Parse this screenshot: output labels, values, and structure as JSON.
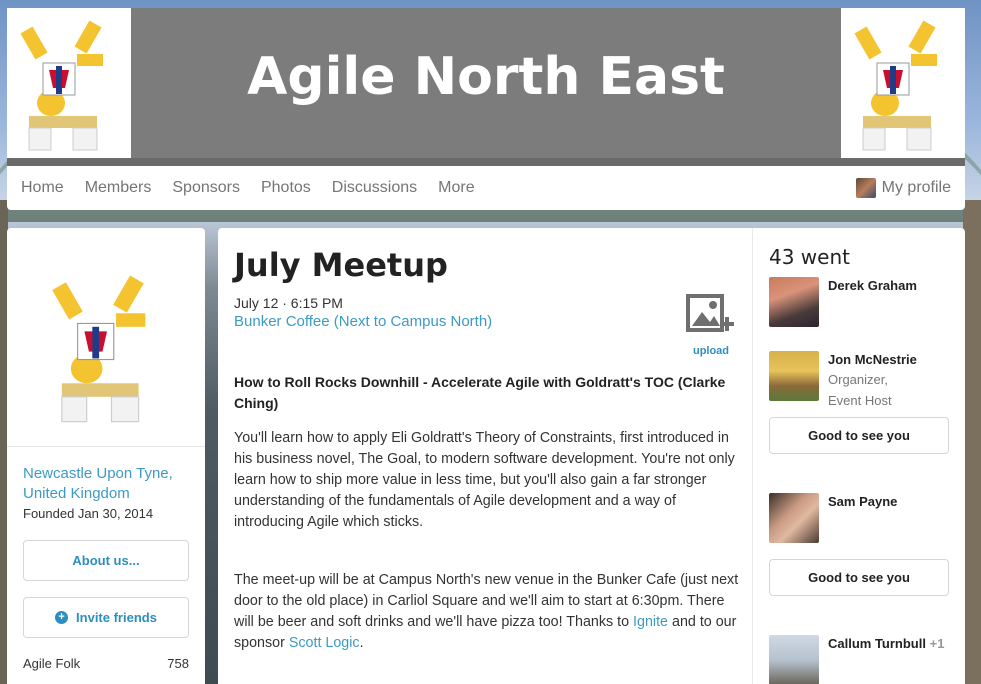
{
  "header": {
    "title": "Agile North East"
  },
  "nav": {
    "items": [
      "Home",
      "Members",
      "Sponsors",
      "Photos",
      "Discussions",
      "More"
    ],
    "profile_label": "My profile"
  },
  "group": {
    "location": "Newcastle Upon Tyne, United Kingdom",
    "founded": "Founded Jan 30, 2014",
    "about_label": "About us...",
    "invite_label": "Invite friends",
    "member_term": "Agile Folk",
    "member_count": "758"
  },
  "event": {
    "title": "July Meetup",
    "date": "July 12 · 6:15 PM",
    "venue": "Bunker Coffee (Next to Campus North)",
    "upload_label": "upload",
    "talk_title": "How to Roll Rocks Downhill - Accelerate Agile with Goldratt's TOC (Clarke Ching)",
    "para1": "You'll learn how to apply Eli Goldratt's Theory of Constraints, first introduced in his business novel, The Goal, to modern software development. You're not only learn how to ship more value in less time, but you'll also gain a far stronger understanding of the fundamentals of Agile development and a way of introducing Agile which sticks.",
    "para2_text": "The meet-up will be at Campus North's new venue in the Bunker Cafe (just next door to the old place) in Carliol Square and we'll aim to start at 6:30pm. There will be beer and soft drinks and we'll have pizza too! Thanks to ",
    "para2_link1": "Ignite",
    "para2_mid": " and to our sponsor ",
    "para2_link2": "Scott Logic",
    "para2_end": "."
  },
  "attendance": {
    "went_label": "43 went",
    "greet_label": "Good to see you",
    "attendees": [
      {
        "name": "Derek Graham",
        "role1": "",
        "role2": ""
      },
      {
        "name": "Jon McNestrie",
        "role1": "Organizer,",
        "role2": "Event Host"
      },
      {
        "name": "Sam Payne",
        "role1": "",
        "role2": ""
      },
      {
        "name": "Callum Turnbull",
        "plus": "+1"
      }
    ]
  },
  "colors": {
    "link": "#3d9ac4",
    "button_text": "#2d8fc0",
    "banner": "#7c7c7c"
  }
}
